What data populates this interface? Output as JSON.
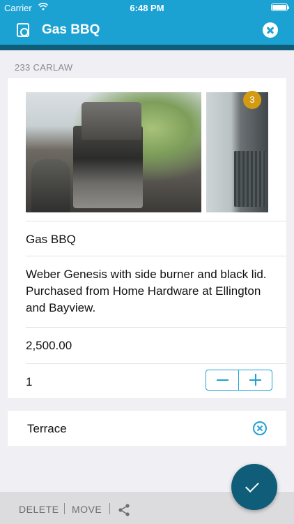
{
  "status_bar": {
    "carrier": "Carrier",
    "time": "6:48 PM"
  },
  "header": {
    "title": "Gas BBQ"
  },
  "section": {
    "label": "233 CARLAW"
  },
  "item": {
    "photo_count": "3",
    "name": "Gas BBQ",
    "description": "Weber Genesis with side burner and black lid. Purchased from Home Hardware at Ellington and Bayview.",
    "price": "2,500.00",
    "quantity": "1"
  },
  "location": {
    "name": "Terrace"
  },
  "toolbar": {
    "delete_label": "DELETE",
    "move_label": "MOVE"
  },
  "colors": {
    "header": "#1ba2d3",
    "header_accent": "#0f5d78",
    "badge": "#d39b12",
    "fab": "#0f5d78"
  },
  "icons": [
    "wifi-icon",
    "battery-icon",
    "app-icon",
    "close-icon",
    "minus-icon",
    "plus-icon",
    "clear-icon",
    "share-icon",
    "check-icon"
  ]
}
